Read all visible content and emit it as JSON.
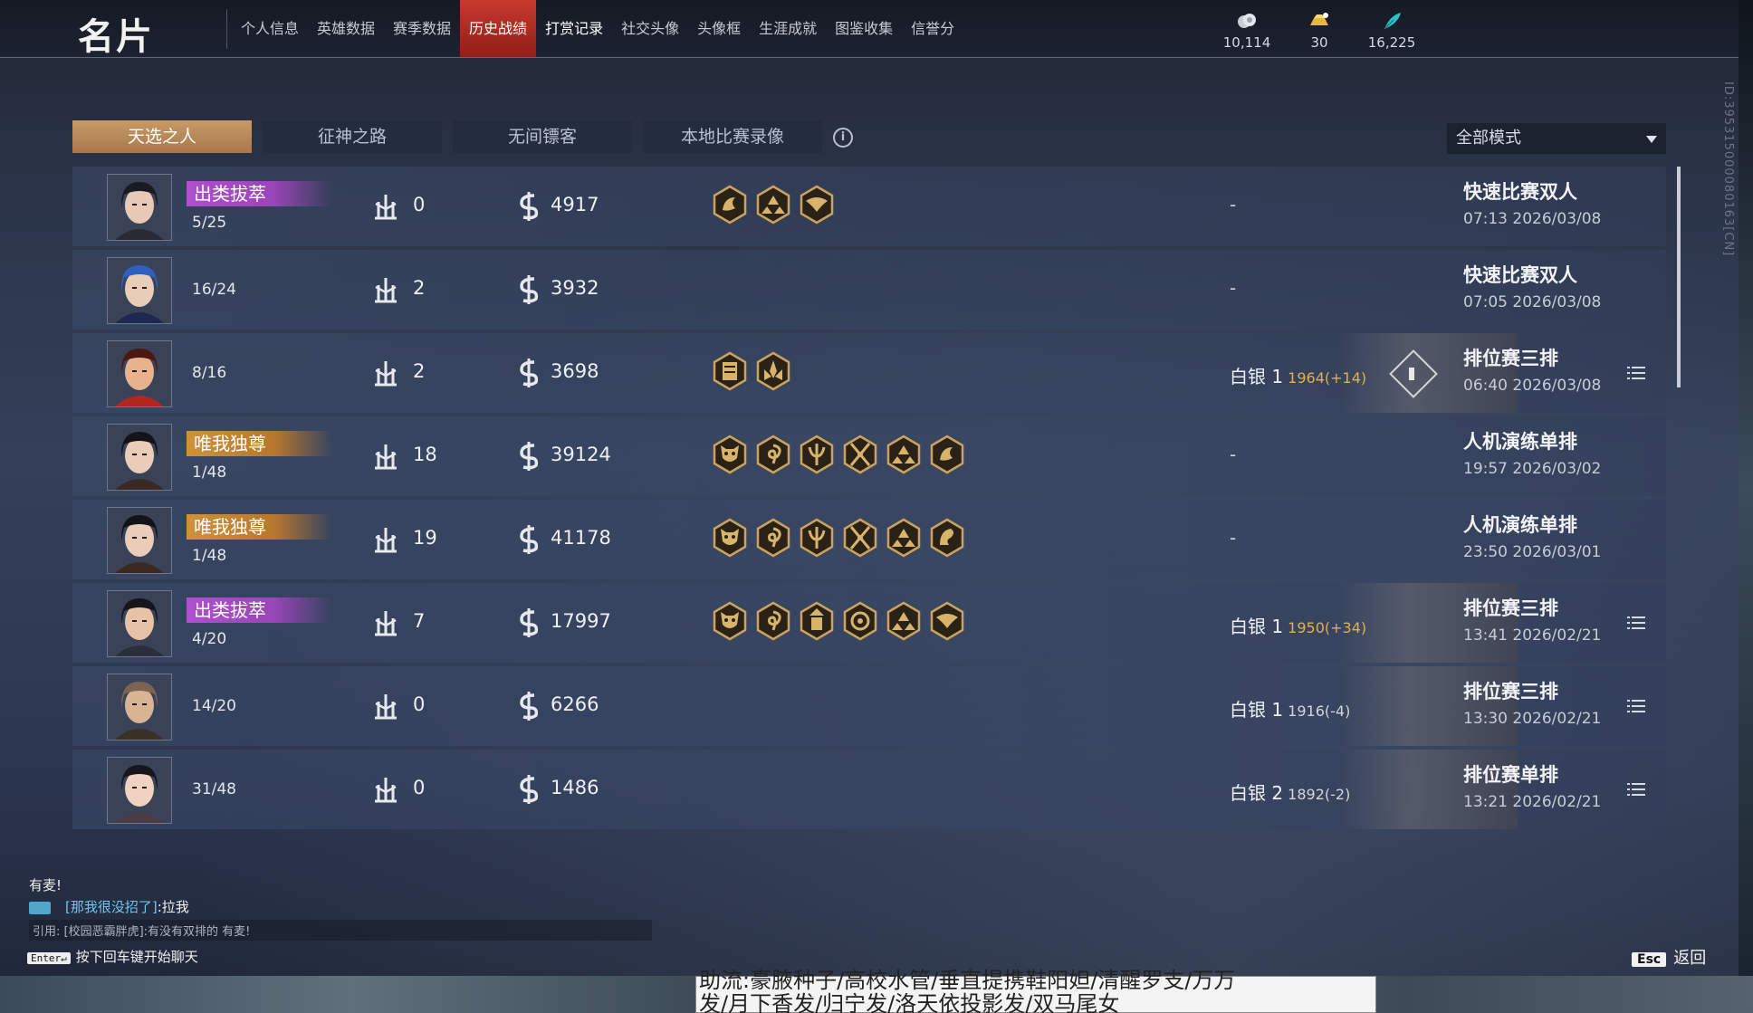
{
  "header": {
    "title": "名片",
    "nav": [
      {
        "label": "个人信息",
        "dot": true
      },
      {
        "label": "英雄数据"
      },
      {
        "label": "赛季数据"
      },
      {
        "label": "历史战绩",
        "active": true
      },
      {
        "label": "打赏记录",
        "bright": true
      },
      {
        "label": "社交头像"
      },
      {
        "label": "头像框"
      },
      {
        "label": "生涯成就"
      },
      {
        "label": "图鉴收集"
      },
      {
        "label": "信誉分"
      }
    ],
    "currencies": [
      {
        "icon": "coin-stack-icon",
        "value": "10,114"
      },
      {
        "icon": "gold-ingot-icon",
        "value": "30"
      },
      {
        "icon": "feather-icon",
        "value": "16,225"
      }
    ]
  },
  "tabs": [
    {
      "label": "天选之人",
      "active": true
    },
    {
      "label": "征神之路"
    },
    {
      "label": "无间镖客"
    },
    {
      "label": "本地比赛录像"
    }
  ],
  "mode_select": {
    "value": "全部模式"
  },
  "matches": [
    {
      "avatar": "hero-female-black-hair",
      "honor": "出类拔萃",
      "honor_style": "purple",
      "rank": "5/25",
      "kills": "0",
      "gold": "4917",
      "items": [
        "dragon-emblem-icon",
        "triad-flame-icon",
        "winged-crest-icon"
      ],
      "score": "-",
      "mode": "快速比赛双人",
      "time": "07:13  2026/03/08",
      "detail": false
    },
    {
      "avatar": "hero-blue-hood",
      "honor": "",
      "honor_style": "",
      "rank": "16/24",
      "kills": "2",
      "gold": "3932",
      "items": [],
      "score": "-",
      "mode": "快速比赛双人",
      "time": "07:05  2026/03/08",
      "detail": false
    },
    {
      "avatar": "hero-red-hat",
      "honor": "",
      "honor_style": "",
      "rank": "8/16",
      "kills": "2",
      "gold": "3698",
      "items": [
        "scroll-tablet-icon",
        "lotus-flame-icon"
      ],
      "score": "白银 1",
      "points": "1964(+14)",
      "points_up": true,
      "mode": "排位赛三排",
      "time": "06:40  2026/03/08",
      "detail": true,
      "deco": true
    },
    {
      "avatar": "hero-female-headband",
      "honor": "唯我独尊",
      "honor_style": "gold",
      "rank": "1/48",
      "kills": "18",
      "gold": "39124",
      "items": [
        "demon-mask-icon",
        "spiral-sigil-icon",
        "trident-rune-icon",
        "crossed-blades-icon",
        "triad-flame-icon",
        "dragon-emblem-icon"
      ],
      "score": "-",
      "mode": "人机演练单排",
      "time": "19:57  2026/03/02",
      "detail": false
    },
    {
      "avatar": "hero-female-headband",
      "honor": "唯我独尊",
      "honor_style": "gold",
      "rank": "1/48",
      "kills": "19",
      "gold": "41178",
      "items": [
        "demon-mask-icon",
        "spiral-sigil-icon",
        "trident-rune-icon",
        "crossed-blades-icon",
        "triad-flame-icon",
        "phoenix-curl-icon"
      ],
      "score": "-",
      "mode": "人机演练单排",
      "time": "23:50  2026/03/01",
      "detail": false
    },
    {
      "avatar": "hero-male-dark-hair",
      "honor": "出类拔萃",
      "honor_style": "purple",
      "rank": "4/20",
      "kills": "7",
      "gold": "17997",
      "items": [
        "demon-mask-icon",
        "spiral-sigil-icon",
        "pagoda-icon",
        "wheel-crest-icon",
        "triad-flame-icon",
        "winged-crest-icon"
      ],
      "score": "白银 1",
      "points": "1950(+34)",
      "points_up": true,
      "mode": "排位赛三排",
      "time": "13:41  2026/02/21",
      "detail": true,
      "deco": true
    },
    {
      "avatar": "hero-bald-monk",
      "honor": "",
      "honor_style": "",
      "rank": "14/20",
      "kills": "0",
      "gold": "6266",
      "items": [],
      "score": "白银 1",
      "points": "1916(-4)",
      "points_up": false,
      "mode": "排位赛三排",
      "time": "13:30  2026/02/21",
      "detail": true,
      "deco": true
    },
    {
      "avatar": "hero-female-bangs",
      "honor": "",
      "honor_style": "",
      "rank": "31/48",
      "kills": "0",
      "gold": "1486",
      "items": [],
      "score": "白银 2",
      "points": "1892(-2)",
      "points_up": false,
      "mode": "排位赛单排",
      "time": "13:21  2026/02/21",
      "detail": true,
      "deco": true
    }
  ],
  "chat": {
    "line1": "有麦!",
    "line2_channel": "[那我很没招了]",
    "line2_text": ":拉我",
    "line3": "引用: [校园恶霸胖虎]:有没有双排的 有麦!",
    "enter_key": "Enter↵",
    "enter_hint": "按下回车键开始聊天"
  },
  "esc": {
    "key": "Esc",
    "label": "返回"
  },
  "side_id": "ID:3953150000801​63[CN]",
  "bottom_text_1": "助流:豪腋种子/高校水管/垂直提携鞋阳妲/清醒罗支/万万",
  "bottom_text_2": "发/月下香发/归宁发/洛天依投影发/双马尾女",
  "colors": {
    "accent_red": "#c8392d",
    "tab_gold": "#c79a68",
    "honor_purple": "#b04fd0",
    "honor_gold": "#d0913a",
    "points_up": "#e3b04a"
  }
}
